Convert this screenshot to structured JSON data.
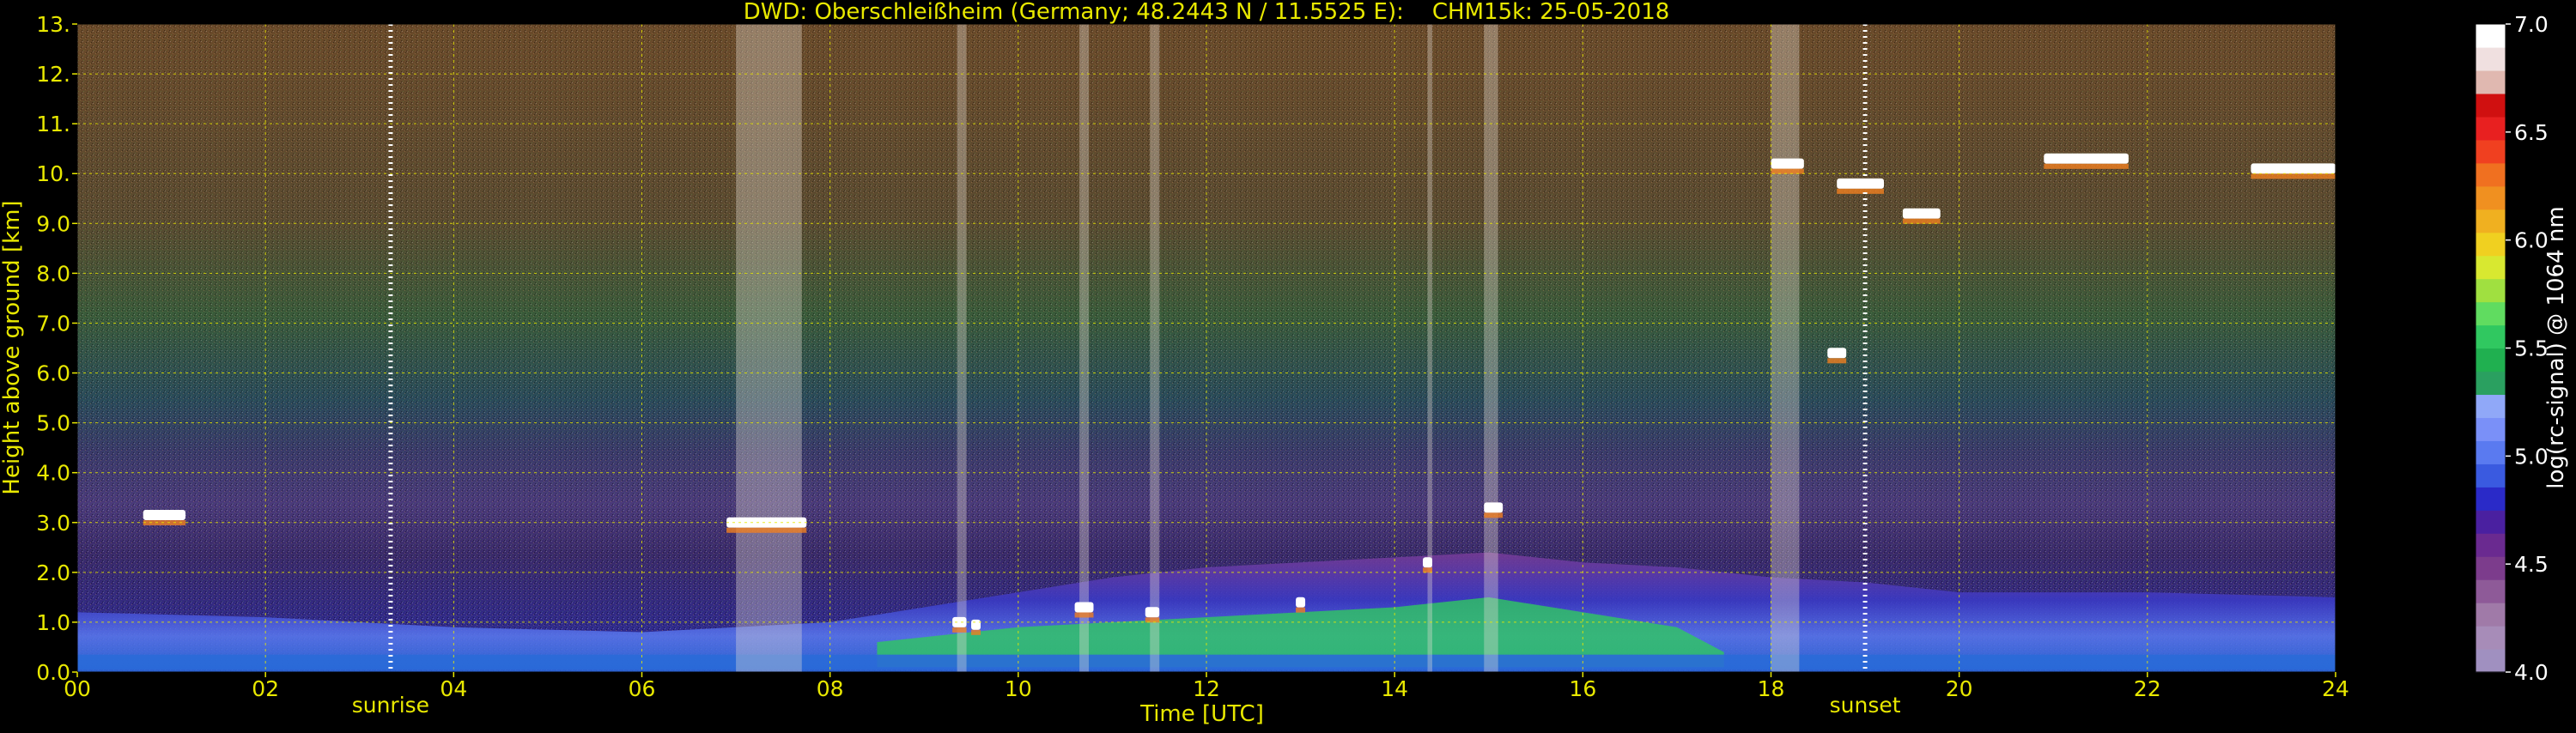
{
  "chart_data": {
    "type": "heatmap",
    "title": "DWD: Oberschleißheim (Germany; 48.2443 N / 11.5525 E):    CHM15k: 25-05-2018",
    "xlabel": "Time [UTC]",
    "ylabel": "Height above ground [km]",
    "xlim": [
      0,
      24
    ],
    "ylim": [
      0,
      13
    ],
    "x_ticks": [
      "00",
      "02",
      "04",
      "06",
      "08",
      "10",
      "12",
      "14",
      "16",
      "18",
      "20",
      "22",
      "24"
    ],
    "y_ticks": [
      "0.0",
      "1.0",
      "2.0",
      "3.0",
      "4.0",
      "5.0",
      "6.0",
      "7.0",
      "8.0",
      "9.0",
      "10.",
      "11.",
      "12.",
      "13."
    ],
    "grid": true,
    "colorbar": {
      "label": "log(rc-signal) @ 1064 nm",
      "min": 4.0,
      "max": 7.0,
      "ticks": [
        "4.0",
        "4.5",
        "5.0",
        "5.5",
        "6.0",
        "6.5",
        "7.0"
      ],
      "colors": [
        "#a090c0",
        "#a78cb8",
        "#a07aa8",
        "#8e5a98",
        "#7c3c8c",
        "#6a2a90",
        "#4a20a0",
        "#2a2ac8",
        "#3a5ae0",
        "#5a7af0",
        "#7a90f8",
        "#90a8f8",
        "#2aa060",
        "#20b050",
        "#30c860",
        "#60dc60",
        "#a0e040",
        "#d8e830",
        "#f0d020",
        "#f0b020",
        "#f09020",
        "#f07020",
        "#f04020",
        "#e82020",
        "#d01010",
        "#e0b8b0",
        "#f0e0e0",
        "#ffffff"
      ]
    },
    "markers": [
      {
        "label": "sunrise",
        "x": 3.33
      },
      {
        "label": "sunset",
        "x": 19.0
      }
    ],
    "features": {
      "boundary_layer_top_km": [
        [
          0,
          1.2
        ],
        [
          2,
          1.1
        ],
        [
          4,
          0.9
        ],
        [
          6,
          0.8
        ],
        [
          8,
          1.0
        ],
        [
          9,
          1.3
        ],
        [
          10,
          1.6
        ],
        [
          11,
          1.9
        ],
        [
          12,
          2.1
        ],
        [
          13,
          2.2
        ],
        [
          14,
          2.3
        ],
        [
          15,
          2.4
        ],
        [
          16,
          2.2
        ],
        [
          17,
          2.1
        ],
        [
          18,
          1.9
        ],
        [
          19,
          1.8
        ],
        [
          20,
          1.6
        ],
        [
          22,
          1.6
        ],
        [
          24,
          1.5
        ]
      ],
      "clouds": [
        {
          "x0": 0.7,
          "x1": 1.15,
          "h": 3.15
        },
        {
          "x0": 6.9,
          "x1": 7.75,
          "h": 3.0
        },
        {
          "x0": 9.3,
          "x1": 9.45,
          "h": 1.0
        },
        {
          "x0": 9.5,
          "x1": 9.6,
          "h": 0.95
        },
        {
          "x0": 10.6,
          "x1": 10.8,
          "h": 1.3
        },
        {
          "x0": 11.35,
          "x1": 11.5,
          "h": 1.2
        },
        {
          "x0": 12.95,
          "x1": 13.05,
          "h": 1.4
        },
        {
          "x0": 14.3,
          "x1": 14.4,
          "h": 2.2
        },
        {
          "x0": 14.95,
          "x1": 15.15,
          "h": 3.3
        },
        {
          "x0": 18.0,
          "x1": 18.35,
          "h": 10.2
        },
        {
          "x0": 18.7,
          "x1": 19.2,
          "h": 9.8
        },
        {
          "x0": 19.4,
          "x1": 19.8,
          "h": 9.2
        },
        {
          "x0": 20.9,
          "x1": 21.8,
          "h": 10.3
        },
        {
          "x0": 23.1,
          "x1": 24.0,
          "h": 10.1
        },
        {
          "x0": 18.6,
          "x1": 18.8,
          "h": 6.4
        }
      ],
      "precip_streaks": [
        {
          "x0": 7.0,
          "x1": 7.7
        },
        {
          "x0": 9.35,
          "x1": 9.45
        },
        {
          "x0": 10.65,
          "x1": 10.75
        },
        {
          "x0": 11.4,
          "x1": 11.5
        },
        {
          "x0": 14.35,
          "x1": 14.4
        },
        {
          "x0": 14.95,
          "x1": 15.1
        },
        {
          "x0": 18.0,
          "x1": 18.3
        }
      ]
    }
  }
}
